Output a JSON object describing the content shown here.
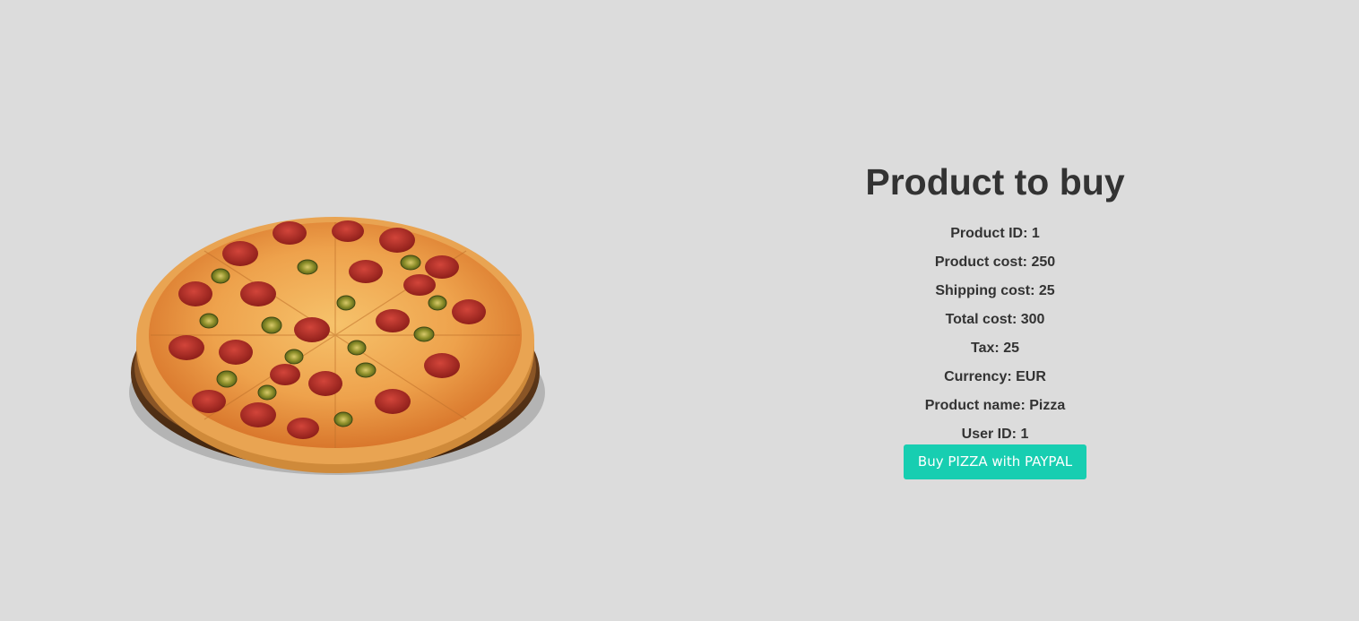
{
  "main": {
    "image_alt": "Pizza",
    "title": "Product to buy",
    "details": [
      {
        "label": "Product ID",
        "value": "1"
      },
      {
        "label": "Product cost",
        "value": "250"
      },
      {
        "label": "Shipping cost",
        "value": "25"
      },
      {
        "label": "Total cost",
        "value": "300"
      },
      {
        "label": "Tax",
        "value": "25"
      },
      {
        "label": "Currency",
        "value": "EUR"
      },
      {
        "label": "Product name",
        "value": "Pizza"
      },
      {
        "label": "User ID",
        "value": "1"
      }
    ],
    "buy_button_label": "Buy PIZZA with PAYPAL"
  },
  "colors": {
    "page_background": "#dcdcdc",
    "text": "#333333",
    "button_background": "#17ceb1",
    "button_text": "#ffffff"
  }
}
